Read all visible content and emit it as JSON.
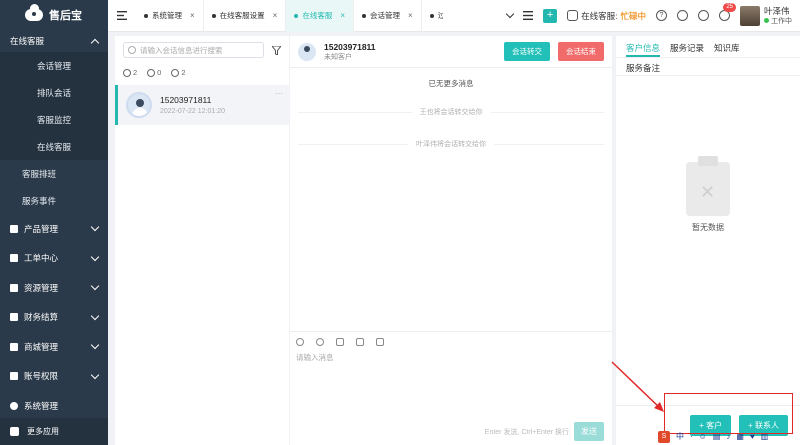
{
  "sidebar": {
    "brand": "售后宝",
    "group_label": "在线客服",
    "sub_items": [
      "会话管理",
      "排队会话",
      "客服监控",
      "在线客服"
    ],
    "flat_items": [
      "客服排班",
      "服务事件"
    ],
    "items": [
      "产品管理",
      "工单中心",
      "资源管理",
      "财务结算",
      "商城管理",
      "账号权限",
      "系统管理"
    ],
    "bottom": "更多应用"
  },
  "topbar": {
    "tabs": [
      {
        "label": "系统管理"
      },
      {
        "label": "在线客服设置"
      },
      {
        "label": "在线客服"
      },
      {
        "label": "会话管理"
      },
      {
        "label": "过"
      }
    ],
    "status_label": "在线客服:",
    "status_value": "忙碌中",
    "notification_count": "25",
    "user_name": "叶泽伟",
    "user_status": "工作中"
  },
  "session_list": {
    "search_placeholder": "请输入会话信息进行搜索",
    "counts": [
      "2",
      "0",
      "2"
    ],
    "sessions": [
      {
        "name": "15203971811",
        "time": "2022-07-22 12:01:20"
      }
    ]
  },
  "chat": {
    "title": "15203971811",
    "subtitle": "未知客户",
    "transfer_button": "会话转交",
    "end_button": "会话结束",
    "no_more": "已无更多消息",
    "system_messages": [
      "王也将会话转交给你",
      "叶泽伟将会话转交给你"
    ],
    "input_placeholder": "请输入消息",
    "hint": "Enter 发送, Ctrl+Enter 换行",
    "send": "发送"
  },
  "info": {
    "tabs": [
      "客户信息",
      "服务记录",
      "知识库"
    ],
    "remark": "服务备注",
    "empty": "暂无数据",
    "add_customer": "+ 客户",
    "add_contact": "+ 联系人"
  },
  "ime": {
    "logo": "S",
    "label": "中"
  },
  "colors": {
    "accent": "#22b8b0",
    "sidebar": "#2b3a4a",
    "danger": "#f26b6b",
    "busy": "#f29d38"
  }
}
